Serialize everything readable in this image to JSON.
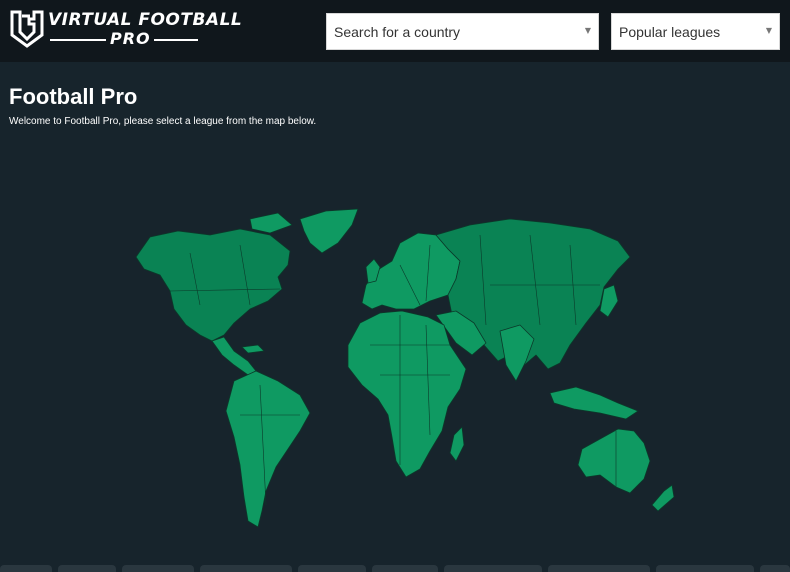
{
  "header": {
    "logo_line1": "VIRTUAL FOOTBALL",
    "logo_line2": "PRO",
    "country_select": {
      "selected": "Search for a country"
    },
    "leagues_select": {
      "selected": "Popular leagues"
    }
  },
  "main": {
    "title": "Football Pro",
    "subtitle": "Welcome to Football Pro, please select a league from the map below."
  },
  "colors": {
    "topbar": "#10171c",
    "background": "#17242c",
    "land": "#0f9a62",
    "land_dark": "#0a8354",
    "borders": "#0b3a2a"
  },
  "icons": {
    "logo": "vf-shield-icon",
    "dropdown": "chevron-down-icon"
  }
}
